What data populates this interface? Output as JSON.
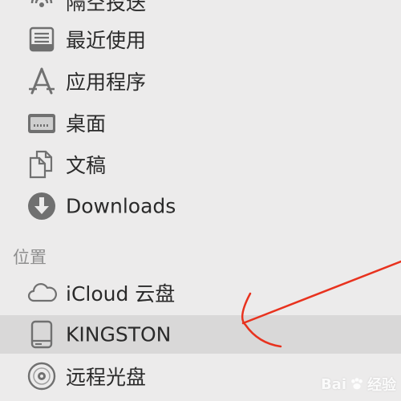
{
  "sidebar": {
    "items": [
      {
        "label": "隔空投送",
        "icon": "airdrop-icon"
      },
      {
        "label": "最近使用",
        "icon": "recents-icon"
      },
      {
        "label": "应用程序",
        "icon": "applications-icon"
      },
      {
        "label": "桌面",
        "icon": "desktop-icon"
      },
      {
        "label": "文稿",
        "icon": "documents-icon"
      },
      {
        "label": "Downloads",
        "icon": "downloads-icon"
      }
    ],
    "locations_header": "位置",
    "locations": [
      {
        "label": "iCloud 云盘",
        "icon": "cloud-icon",
        "selected": false
      },
      {
        "label": "KINGSTON",
        "icon": "drive-icon",
        "selected": true
      },
      {
        "label": "远程光盘",
        "icon": "disc-icon",
        "selected": false
      }
    ]
  },
  "colors": {
    "background": "#ecebeb",
    "selected_row": "#d9d8d8",
    "icon_gray": "#707070",
    "annotation_red": "#e8321e"
  },
  "watermark": {
    "text": "Bai",
    "text2": "经验"
  }
}
